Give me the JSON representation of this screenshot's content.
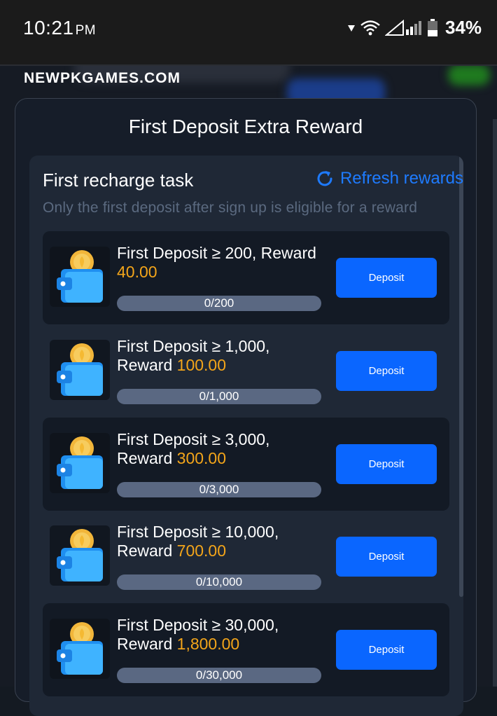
{
  "status_bar": {
    "time": "10:21",
    "ampm": "PM",
    "battery": "34%",
    "icons": [
      "location-arrow-icon",
      "wifi-icon",
      "signal-icon",
      "battery-icon"
    ]
  },
  "site_label": "NEWPKGAMES.COM",
  "modal": {
    "title": "First Deposit Extra Reward",
    "task_title": "First recharge task",
    "refresh_label": "Refresh rewards",
    "subtitle": "Only the first deposit after sign up is eligible for a reward",
    "items": [
      {
        "line1": "First Deposit ≥ 200, Reward",
        "line2_prefix": "",
        "reward": "40.00",
        "progress_text": "0/200",
        "progress": 0,
        "button": "Deposit"
      },
      {
        "line1": "First Deposit ≥ 1,000,",
        "line2_prefix": "Reward ",
        "reward": "100.00",
        "progress_text": "0/1,000",
        "progress": 0,
        "button": "Deposit"
      },
      {
        "line1": "First Deposit ≥ 3,000,",
        "line2_prefix": "Reward ",
        "reward": "300.00",
        "progress_text": "0/3,000",
        "progress": 0,
        "button": "Deposit"
      },
      {
        "line1": "First Deposit ≥ 10,000,",
        "line2_prefix": "Reward ",
        "reward": "700.00",
        "progress_text": "0/10,000",
        "progress": 0,
        "button": "Deposit"
      },
      {
        "line1": "First Deposit ≥ 30,000,",
        "line2_prefix": "Reward ",
        "reward": "1,800.00",
        "progress_text": "0/30,000",
        "progress": 0,
        "button": "Deposit"
      }
    ]
  },
  "colors": {
    "accent_blue": "#0a66ff",
    "reward_orange": "#f3a51a",
    "refresh_blue": "#1e7bff"
  }
}
